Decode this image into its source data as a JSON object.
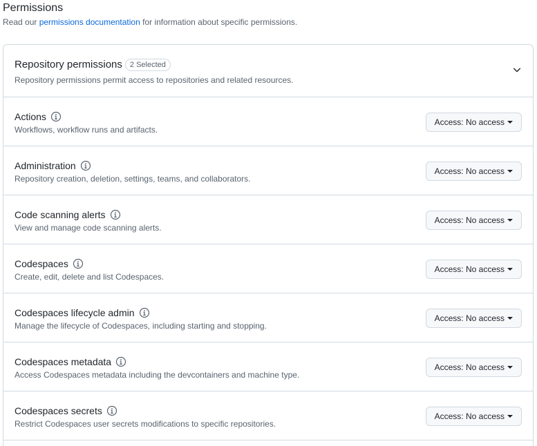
{
  "header": {
    "title": "Permissions",
    "intro_before": "Read our ",
    "intro_link": "permissions documentation",
    "intro_after": " for information about specific permissions."
  },
  "repository": {
    "title": "Repository permissions",
    "badge": "2 Selected",
    "description": "Repository permissions permit access to repositories and related resources."
  },
  "permissions": [
    {
      "name": "Actions",
      "description": "Workflows, workflow runs and artifacts.",
      "access": "Access: No access"
    },
    {
      "name": "Administration",
      "description": "Repository creation, deletion, settings, teams, and collaborators.",
      "access": "Access: No access"
    },
    {
      "name": "Code scanning alerts",
      "description": "View and manage code scanning alerts.",
      "access": "Access: No access"
    },
    {
      "name": "Codespaces",
      "description": "Create, edit, delete and list Codespaces.",
      "access": "Access: No access"
    },
    {
      "name": "Codespaces lifecycle admin",
      "description": "Manage the lifecycle of Codespaces, including starting and stopping.",
      "access": "Access: No access"
    },
    {
      "name": "Codespaces metadata",
      "description": "Access Codespaces metadata including the devcontainers and machine type.",
      "access": "Access: No access"
    },
    {
      "name": "Codespaces secrets",
      "description": "Restrict Codespaces user secrets modifications to specific repositories.",
      "access": "Access: No access"
    }
  ],
  "colors": {
    "link": "#0969da",
    "muted_text": "#59636e",
    "border": "#d1d9e0",
    "button_bg": "#f6f8fa"
  }
}
